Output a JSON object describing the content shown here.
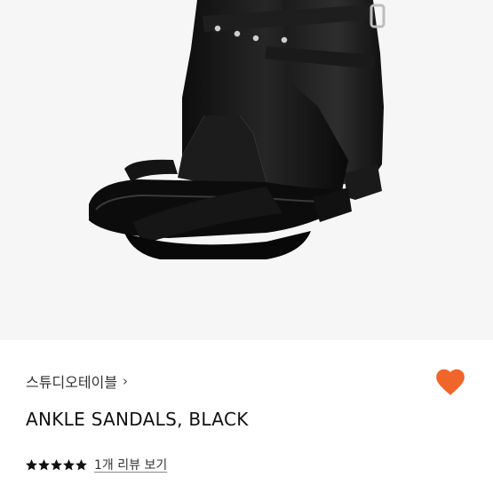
{
  "product": {
    "image": {
      "icon": "black-leather-ankle-sandal-photo",
      "background_color": "#f6f6f6"
    },
    "brand": {
      "name": "스튜디오테이블",
      "chevron_icon": "chevron-right-icon",
      "chevron_glyph": "›"
    },
    "wishlist": {
      "icon": "heart-icon",
      "color": "#f06529",
      "state": "active"
    },
    "title": "ANKLE SANDALS, BLACK",
    "rating": {
      "value": 5,
      "max": 5,
      "star_icon": "star-icon",
      "star_color": "#111111",
      "review_link": "1개 리뷰 보기"
    }
  }
}
